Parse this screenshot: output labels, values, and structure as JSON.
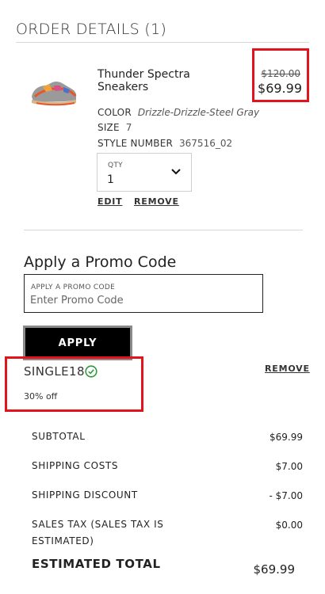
{
  "header": {
    "title": "ORDER DETAILS (1)"
  },
  "item": {
    "name": "Thunder Spectra Sneakers",
    "price_original": "$120.00",
    "price_sale": "$69.99",
    "color_label": "COLOR",
    "color_value": "Drizzle-Drizzle-Steel Gray",
    "size_label": "SIZE",
    "size_value": "7",
    "style_label": "STYLE NUMBER",
    "style_value": "367516_02",
    "qty_label": "QTY",
    "qty_value": "1",
    "edit_label": "EDIT",
    "remove_label": "REMOVE"
  },
  "promo": {
    "title": "Apply a Promo Code",
    "input_label": "APPLY A PROMO CODE",
    "input_placeholder": "Enter Promo Code",
    "apply_label": "APPLY",
    "applied_code": "SINGLE18",
    "applied_desc": "30% off",
    "remove_label": "REMOVE"
  },
  "summary": {
    "rows": [
      {
        "label": "SUBTOTAL",
        "value": "$69.99"
      },
      {
        "label": "SHIPPING COSTS",
        "value": "$7.00"
      },
      {
        "label": "SHIPPING DISCOUNT",
        "value": "- $7.00"
      },
      {
        "label": "SALES TAX (SALES TAX IS ESTIMATED)",
        "value": "$0.00"
      }
    ],
    "total_label": "ESTIMATED TOTAL",
    "total_value": "$69.99"
  },
  "colors": {
    "highlight_border": "#e1141c",
    "success_green": "#2e9a3e",
    "button_black": "#000000"
  },
  "icons": [
    "chevron-down-icon",
    "check-circle-icon"
  ]
}
